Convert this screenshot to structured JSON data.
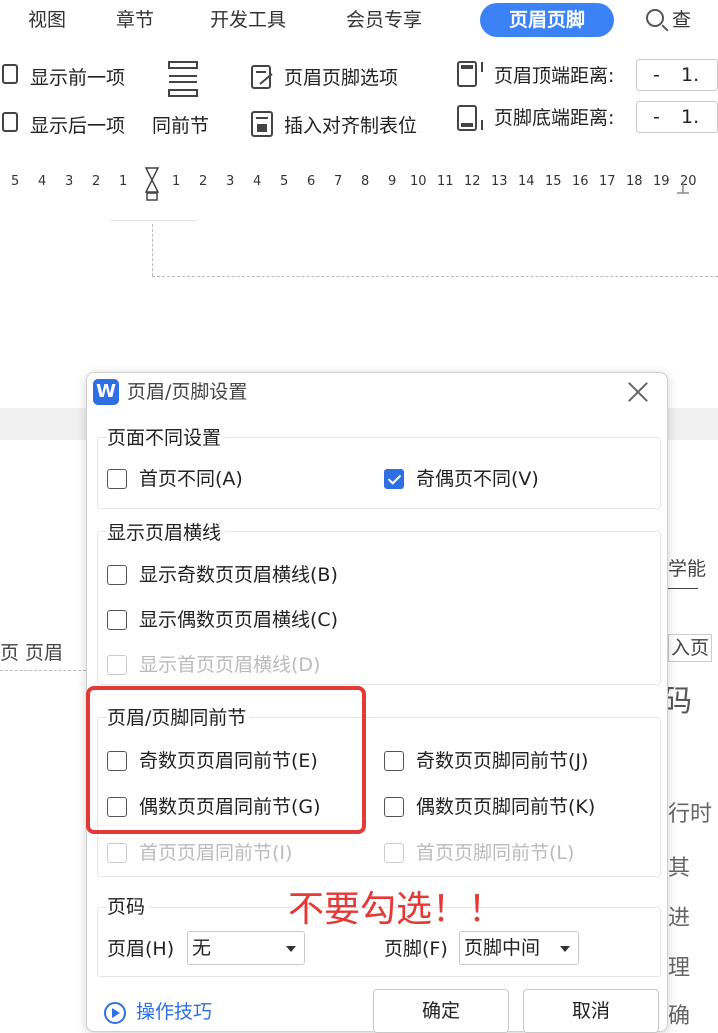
{
  "menu": {
    "items": [
      "视图",
      "章节",
      "开发工具",
      "会员专享"
    ],
    "active": "页眉页脚",
    "search_label": "查"
  },
  "ribbon": {
    "show_prev": "显示前一项",
    "show_next": "显示后一项",
    "same_as_prev": "同前节",
    "hf_options": "页眉页脚选项",
    "insert_align_tab": "插入对齐制表位",
    "header_top_distance": "页眉顶端距离:",
    "footer_bottom_distance": "页脚底端距离:",
    "minus": "-",
    "value_partial": "1."
  },
  "ruler": {
    "left_ticks": [
      "5",
      "4",
      "3",
      "2",
      "1"
    ],
    "right_ticks": [
      "1",
      "2",
      "3",
      "4",
      "5",
      "6",
      "7",
      "8",
      "9",
      "10",
      "11",
      "12",
      "13",
      "14",
      "15",
      "16",
      "17",
      "18",
      "19",
      "20"
    ]
  },
  "background": {
    "left_header_label": "页 页眉",
    "right_top": "学能",
    "right_mid": "入页",
    "big_char": "码",
    "chars": [
      "行时",
      "其",
      "进",
      "理",
      "确"
    ]
  },
  "dialog": {
    "logo": "W",
    "title": "页眉/页脚设置",
    "group1": {
      "title": "页面不同设置",
      "first_page": "首页不同(A)",
      "odd_even": "奇偶页不同(V)"
    },
    "group2": {
      "title": "显示页眉横线",
      "odd_line": "显示奇数页页眉横线(B)",
      "even_line": "显示偶数页页眉横线(C)",
      "first_line": "显示首页页眉横线(D)"
    },
    "group3": {
      "title": "页眉/页脚同前节",
      "odd_header": "奇数页页眉同前节(E)",
      "even_header": "偶数页页眉同前节(G)",
      "first_header": "首页页眉同前节(I)",
      "odd_footer": "奇数页页脚同前节(J)",
      "even_footer": "偶数页页脚同前节(K)",
      "first_footer": "首页页脚同前节(L)"
    },
    "group4": {
      "title": "页码",
      "header_label": "页眉(H)",
      "header_value": "无",
      "footer_label": "页脚(F)",
      "footer_value": "页脚中间"
    },
    "tips": "操作技巧",
    "ok": "确定",
    "cancel": "取消"
  },
  "annotation": "不要勾选！！",
  "colors": {
    "accent": "#2f6fe4",
    "menu_active_bg": "#3b82f6",
    "annotation_red": "#e53935"
  }
}
